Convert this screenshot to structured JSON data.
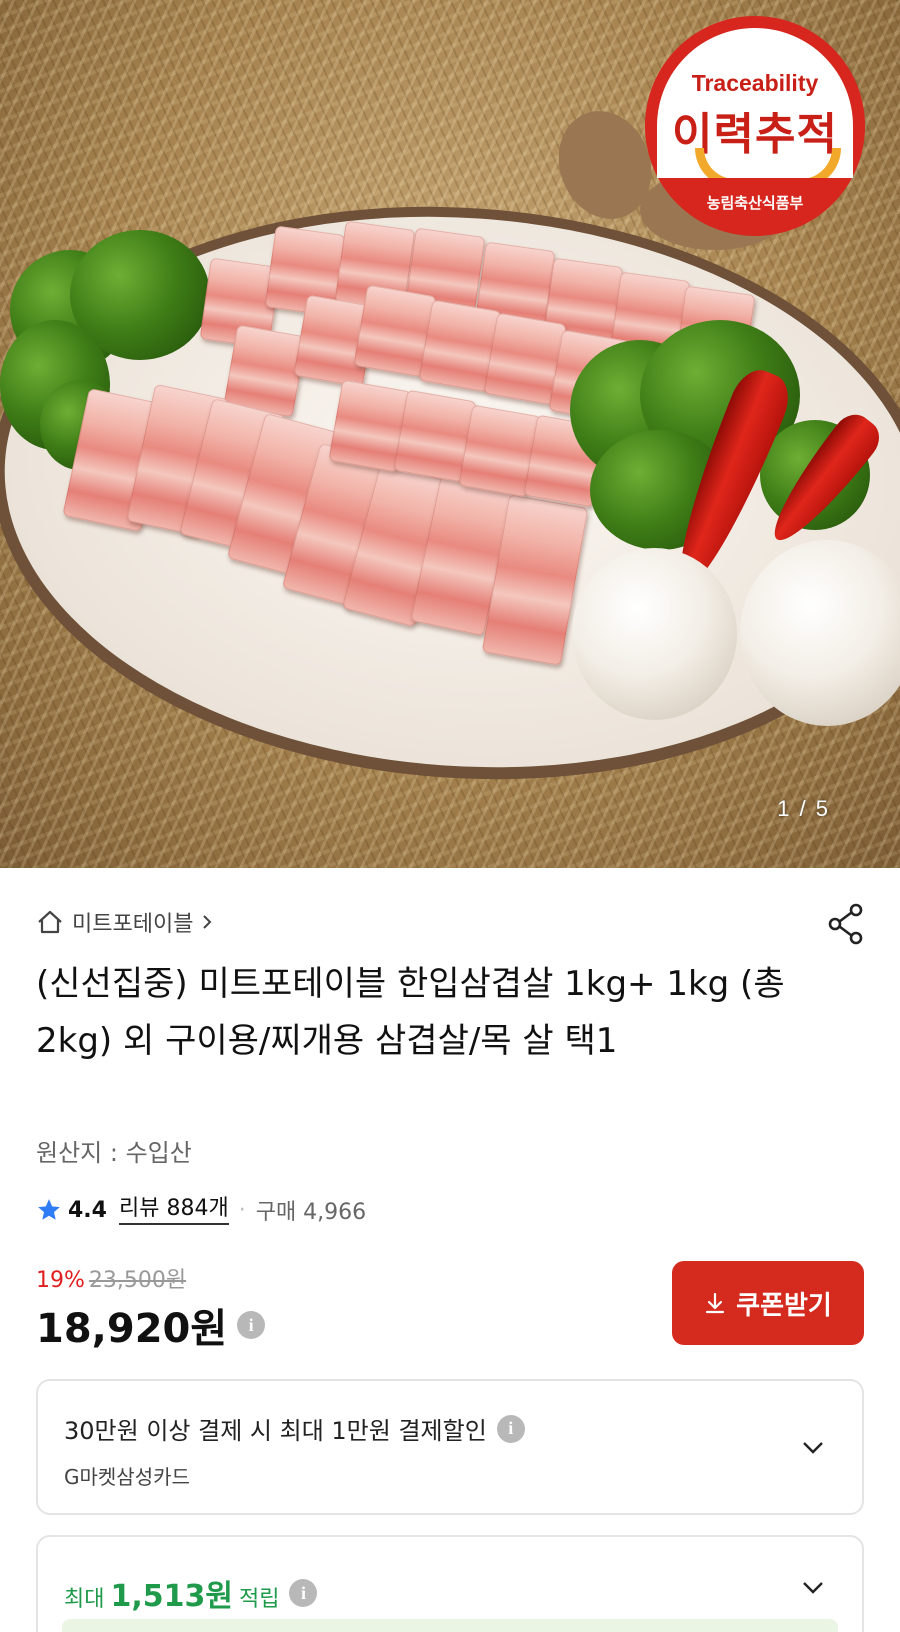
{
  "gallery": {
    "counter": "1 / 5",
    "badge": {
      "top_text": "Traceability",
      "main_text": "이력추적",
      "bottom_text": "농림축산식품부"
    }
  },
  "breadcrumb": {
    "store": "미트포테이블"
  },
  "product": {
    "title": "(신선집중) 미트포테이블 한입삼겹살 1kg+ 1kg (총2kg) 외 구이용/찌개용 삼겹살/목 살 택1",
    "origin": "원산지 : 수입산",
    "rating": "4.4",
    "review_label": "리뷰 884개",
    "purchase_label": "구매 4,966",
    "discount_percent": "19%",
    "original_price": "23,500원",
    "price": "18,920원"
  },
  "coupon_button": {
    "label": "쿠폰받기"
  },
  "card_benefit": {
    "title": "30만원 이상 결제 시 최대 1만원 결제할인",
    "subtitle": "G마켓삼성카드"
  },
  "points": {
    "prefix": "최대",
    "amount": "1,513원",
    "suffix": "적립"
  },
  "colors": {
    "accent_red": "#d52b1e",
    "discount_red": "#e02020",
    "points_green": "#1e9a4a",
    "star_blue": "#2f7df6"
  }
}
